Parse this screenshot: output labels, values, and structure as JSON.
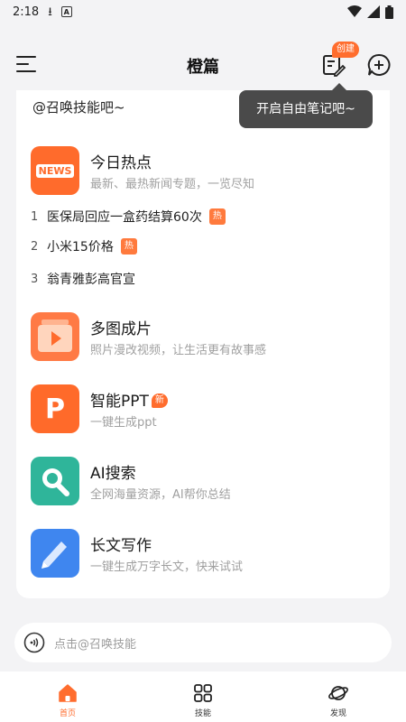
{
  "status_bar": {
    "time": "2:18",
    "download_glyph": "⭳",
    "a_glyph": "A"
  },
  "header": {
    "title": "橙篇",
    "create_badge": "创建"
  },
  "tooltip": {
    "text": "开启自由笔记吧~"
  },
  "greeting": "@召唤技能吧~",
  "features": [
    {
      "title": "今日热点",
      "subtitle": "最新、最热新闻专题，一览尽知",
      "icon_label": "NEWS"
    },
    {
      "title": "多图成片",
      "subtitle": "照片漫改视频，让生活更有故事感"
    },
    {
      "title": "智能PPT",
      "subtitle": "一键生成ppt",
      "badge": "新",
      "icon_label": "P"
    },
    {
      "title": "AI搜索",
      "subtitle": "全网海量资源，AI帮你总结"
    },
    {
      "title": "长文写作",
      "subtitle": "一键生成万字长文，快来试试"
    }
  ],
  "hot_list": [
    {
      "rank": "1",
      "text": "医保局回应一盒药结算60次",
      "tag": "热"
    },
    {
      "rank": "2",
      "text": "小米15价格",
      "tag": "热"
    },
    {
      "rank": "3",
      "text": "翁青雅彭高官宣"
    }
  ],
  "input_bar": {
    "placeholder": "点击@召唤技能"
  },
  "bottom_nav": [
    {
      "label": "首页",
      "active": true
    },
    {
      "label": "技能"
    },
    {
      "label": "发现"
    }
  ],
  "colors": {
    "accent": "#ff6d2e",
    "news_icon": "#ff6b2c",
    "video_icon": "#ff7a45",
    "ppt_icon": "#ff6a2a",
    "search_icon": "#2fb59a",
    "write_icon": "#3f86ef"
  }
}
